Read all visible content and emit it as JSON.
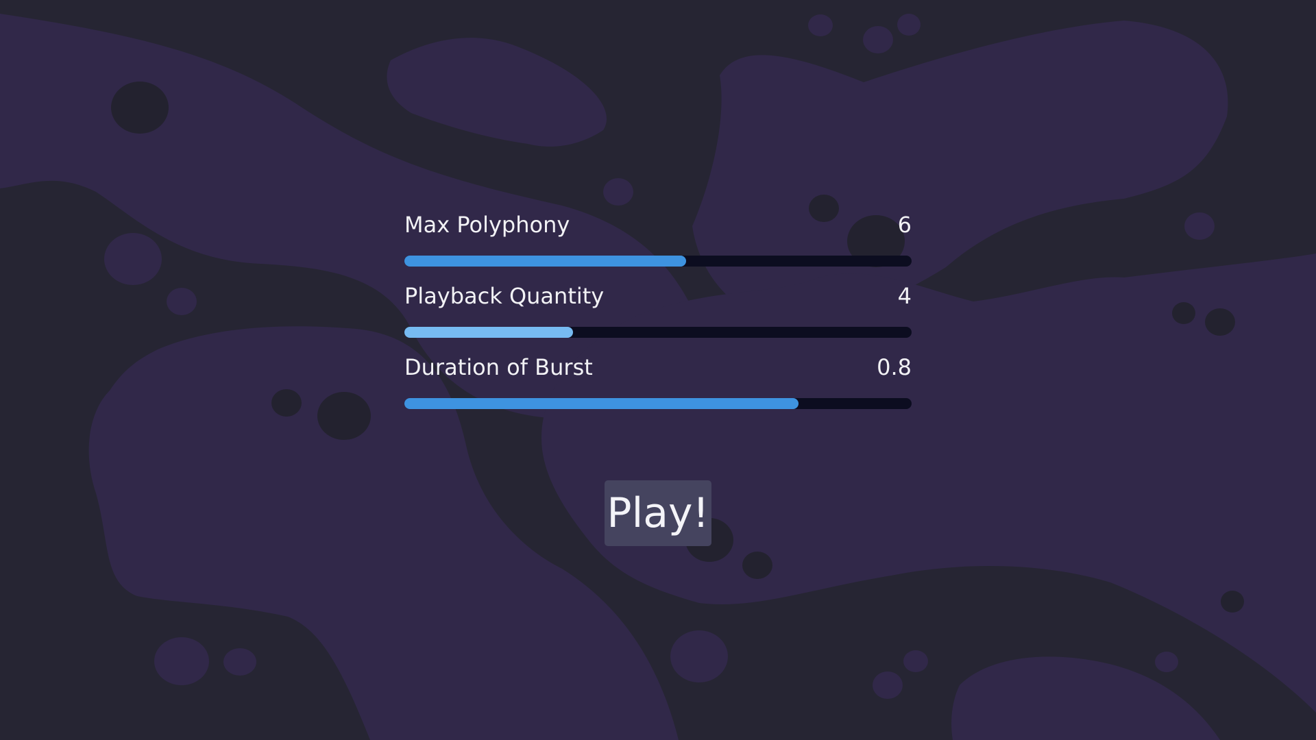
{
  "colors": {
    "background": "#262533",
    "blob": "#312849",
    "dot": "#23222f",
    "track": "#0c0d20",
    "accent": "#3e93e0",
    "accent_light": "#77bbf2",
    "button": "#45445f",
    "text": "#f2f2f5"
  },
  "sliders": [
    {
      "label": "Max Polyphony",
      "value": "6",
      "fill_fraction": 0.555,
      "color": "#3e93e0"
    },
    {
      "label": "Playback Quantity",
      "value": "4",
      "fill_fraction": 0.332,
      "color": "#77bbf2"
    },
    {
      "label": "Duration of Burst",
      "value": "0.8",
      "fill_fraction": 0.777,
      "color": "#3e93e0"
    }
  ],
  "play_button": {
    "label": "Play!"
  }
}
